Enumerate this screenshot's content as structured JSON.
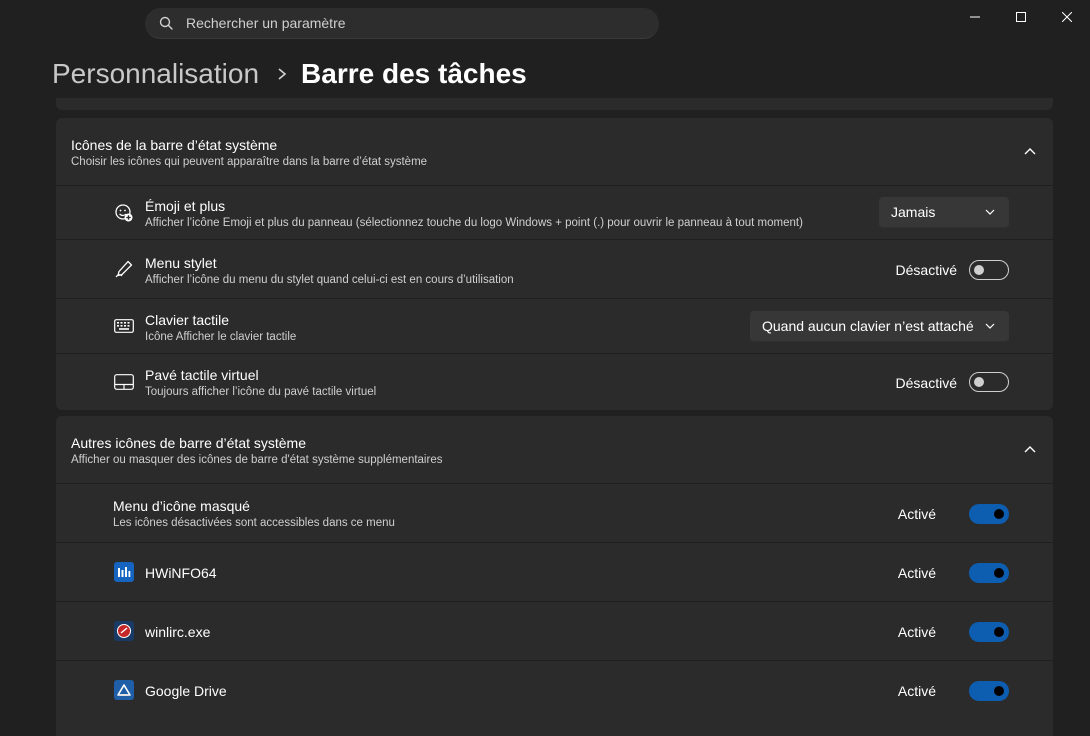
{
  "search": {
    "placeholder": "Rechercher un paramètre"
  },
  "breadcrumb": {
    "parent": "Personnalisation",
    "current": "Barre des tâches"
  },
  "colors": {
    "background": "#202020",
    "card": "#2b2b2b",
    "accent": "#0d5eb0"
  },
  "tray_icons": {
    "title": "Icônes de la barre d’état système",
    "subtitle": "Choisir les icônes qui peuvent apparaître dans la barre d’état système",
    "items": [
      {
        "title": "Émoji et plus",
        "desc": "Afficher l’icône Emoji et plus du panneau (sélectionnez touche du logo Windows + point (.) pour ouvrir le panneau à tout moment)",
        "control": "dropdown",
        "value": "Jamais",
        "icon": "emoji-icon"
      },
      {
        "title": "Menu stylet",
        "desc": "Afficher l’icône du menu du stylet quand celui-ci est en cours d’utilisation",
        "control": "toggle",
        "state_label": "Désactivé",
        "on": false,
        "icon": "pen-icon"
      },
      {
        "title": "Clavier tactile",
        "desc": "Icône Afficher le clavier tactile",
        "control": "dropdown",
        "value": "Quand aucun clavier n’est attaché",
        "icon": "keyboard-icon"
      },
      {
        "title": "Pavé tactile virtuel",
        "desc": "Toujours afficher l’icône du pavé tactile virtuel",
        "control": "toggle",
        "state_label": "Désactivé",
        "on": false,
        "icon": "touchpad-icon"
      }
    ]
  },
  "other_icons": {
    "title": "Autres icônes de barre d’état système",
    "subtitle": "Afficher ou masquer des icônes de barre d'état système supplémentaires",
    "items": [
      {
        "title": "Menu d’icône masqué",
        "desc": "Les icônes désactivées sont accessibles dans ce menu",
        "state_label": "Activé",
        "on": true
      },
      {
        "title": "HWiNFO64",
        "state_label": "Activé",
        "on": true,
        "icon": "hwinfo-icon"
      },
      {
        "title": "winlirc.exe",
        "state_label": "Activé",
        "on": true,
        "icon": "winlirc-icon"
      },
      {
        "title": "Google Drive",
        "state_label": "Activé",
        "on": true,
        "icon": "google-drive-icon"
      }
    ]
  }
}
